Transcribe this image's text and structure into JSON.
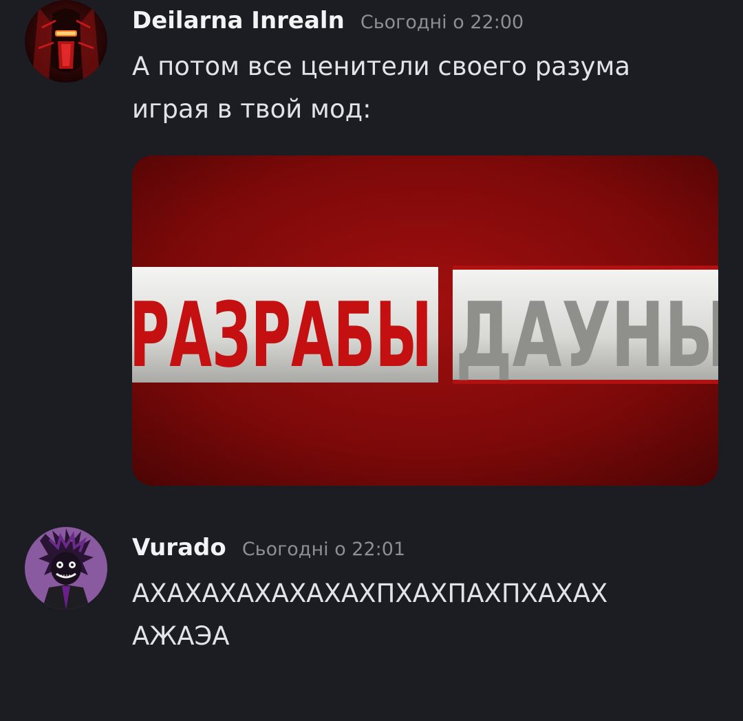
{
  "messages": [
    {
      "username": "Deilarna Inrealn",
      "timestamp": "Сьогодні о 22:00",
      "text_lines": [
        "А потом все ценители своего разума",
        "играя в твой мод:"
      ],
      "attachment": {
        "left_text": "РАЗРАБЫ",
        "right_text": "ДАУНЫ"
      }
    },
    {
      "username": "Vurado",
      "timestamp": "Сьогодні о 22:01",
      "text_lines": [
        "АХАХАХАХАХАХАХПХАХПАХПХАХАХ",
        "АЖАЭА"
      ]
    }
  ],
  "colors": {
    "background": "#1c1d22",
    "username": "#f2f3f5",
    "timestamp": "#8c8f96",
    "text": "#e1e3e8",
    "banner_red": "#8a0a0a"
  }
}
